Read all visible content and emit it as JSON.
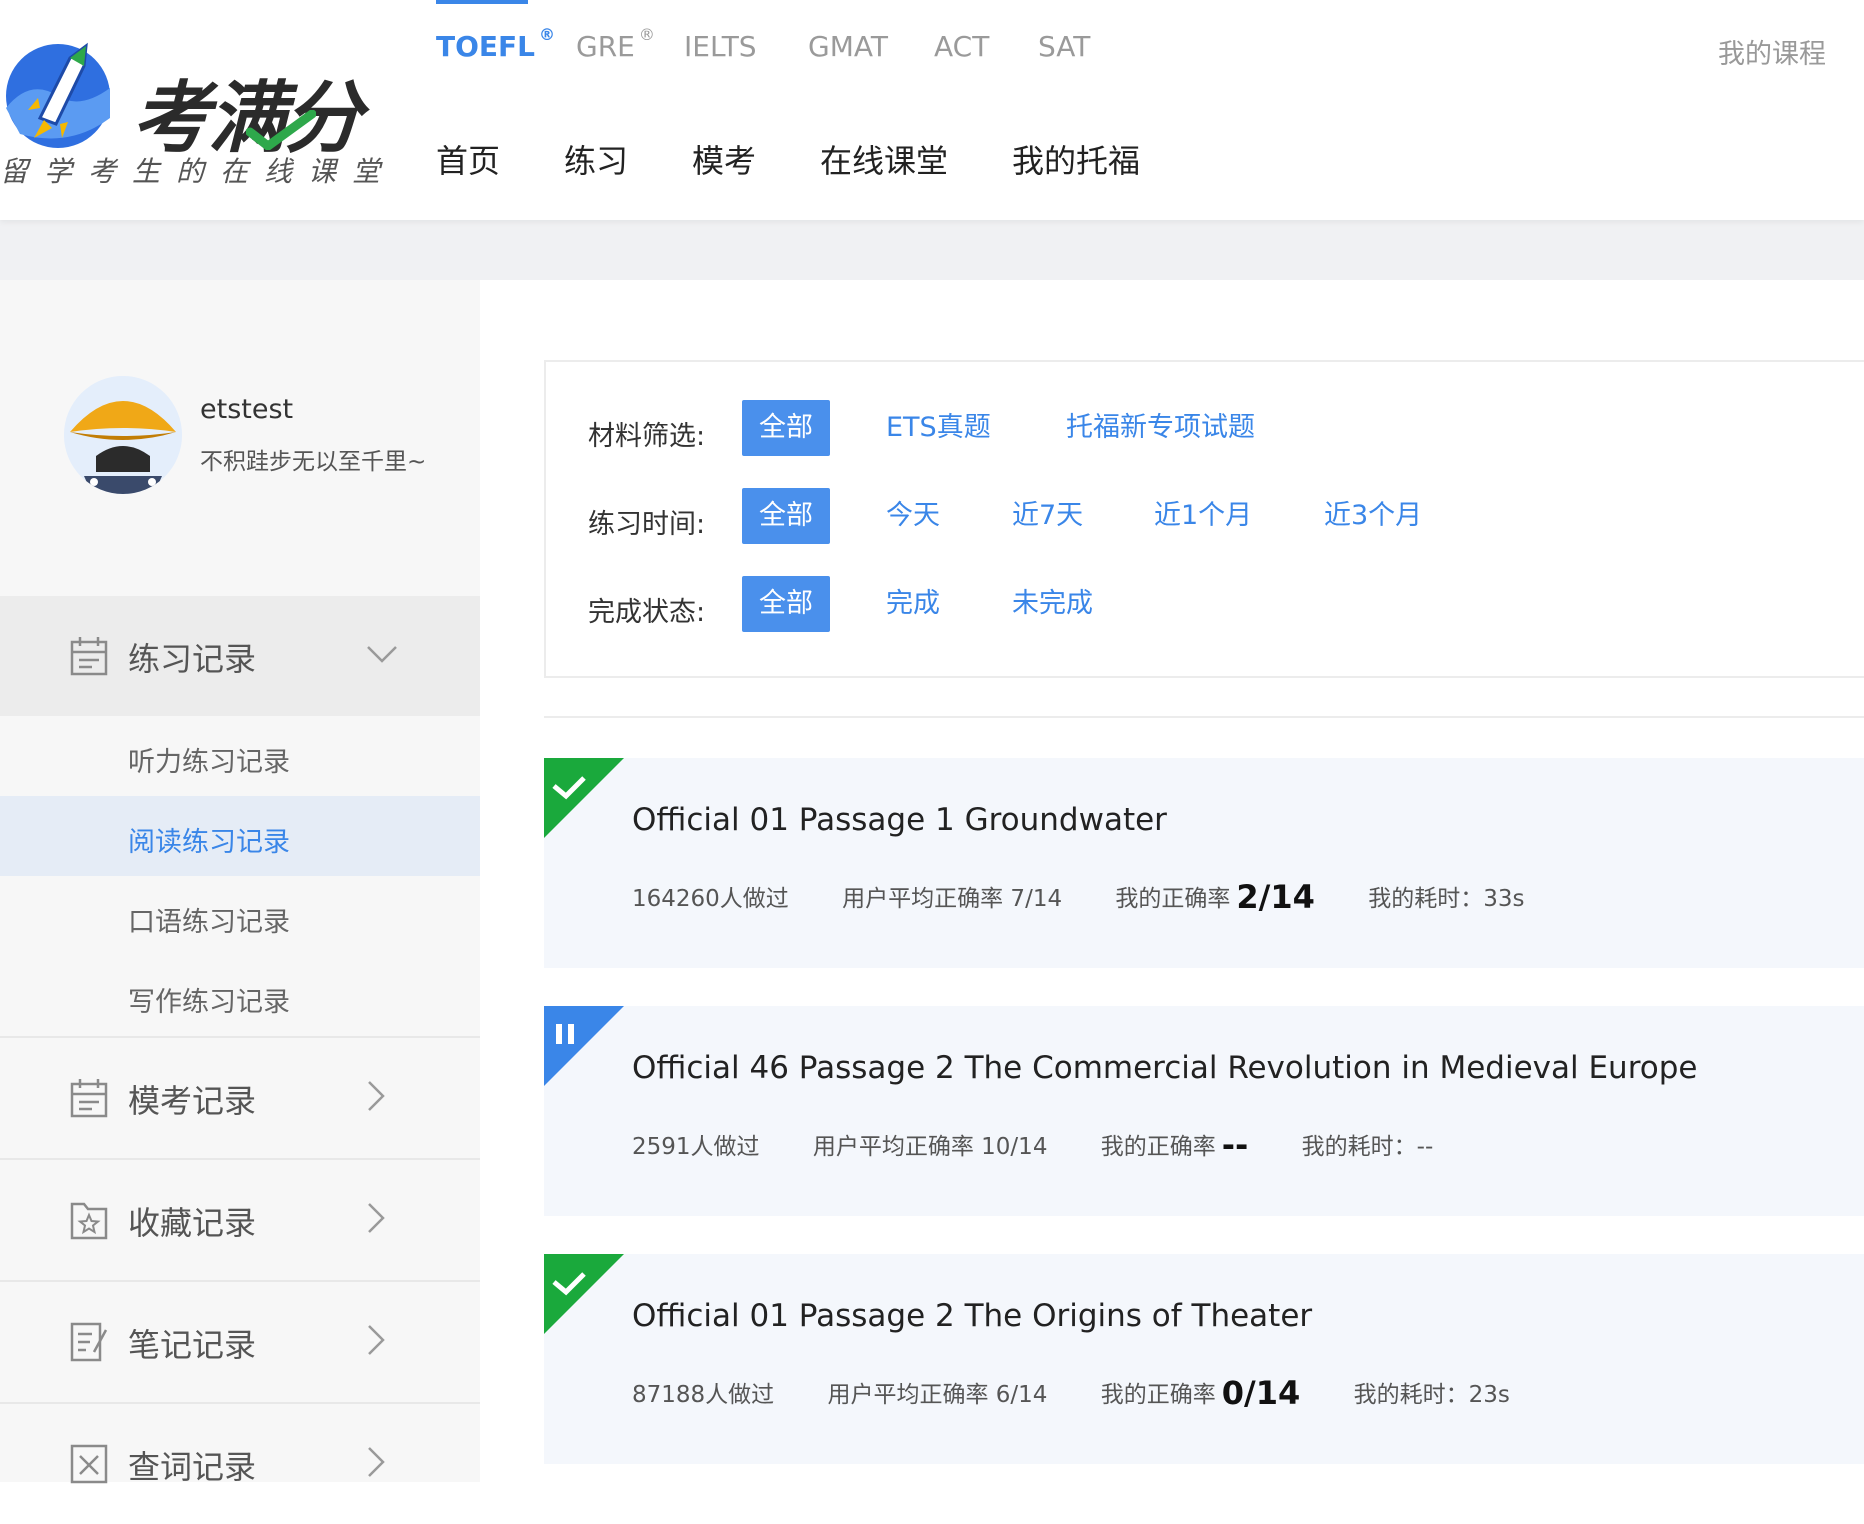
{
  "brand": {
    "name": "考满分",
    "slogan": "留学考生的在线课堂",
    "colors": {
      "accent": "#3a86e8",
      "success": "#1aa93c",
      "paused": "#3a86e8"
    }
  },
  "exam_tabs": [
    {
      "label": "TOEFL",
      "reg": "®",
      "active": true
    },
    {
      "label": "GRE",
      "reg": "®"
    },
    {
      "label": "IELTS",
      "reg": ""
    },
    {
      "label": "GMAT",
      "reg": ""
    },
    {
      "label": "ACT",
      "reg": ""
    },
    {
      "label": "SAT",
      "reg": ""
    }
  ],
  "my_course": "我的课程",
  "main_nav": [
    "首页",
    "练习",
    "模考",
    "在线课堂",
    "我的托福"
  ],
  "user": {
    "name": "etstest",
    "motto": "不积跬步无以至千里~"
  },
  "sidebar": {
    "groups": [
      {
        "label": "练习记录",
        "icon": "calendar-icon",
        "expanded": true
      },
      {
        "label": "模考记录",
        "icon": "calendar-icon"
      },
      {
        "label": "收藏记录",
        "icon": "star-folder-icon"
      },
      {
        "label": "笔记记录",
        "icon": "note-icon"
      },
      {
        "label": "查词记录",
        "icon": "dictionary-icon"
      }
    ],
    "sub_items": [
      "听力练习记录",
      "阅读练习记录",
      "口语练习记录",
      "写作练习记录"
    ],
    "active_sub": "阅读练习记录"
  },
  "filters": {
    "material": {
      "label": "材料筛选:",
      "options": [
        "全部",
        "ETS真题",
        "托福新专项试题"
      ],
      "selected": "全部"
    },
    "time": {
      "label": "练习时间:",
      "options": [
        "全部",
        "今天",
        "近7天",
        "近1个月",
        "近3个月"
      ],
      "selected": "全部"
    },
    "status": {
      "label": "完成状态:",
      "options": [
        "全部",
        "完成",
        "未完成"
      ],
      "selected": "全部"
    }
  },
  "records": [
    {
      "status": "complete",
      "title": "Official 01 Passage 1  Groundwater",
      "done": "164260人做过",
      "avg_label": "用户平均正确率 7/14",
      "my_label": "我的正确率",
      "my_value": "2/14",
      "time": "我的耗时：33s"
    },
    {
      "status": "paused",
      "title": "Official 46 Passage 2  The Commercial Revolution in Medieval Europe",
      "done": "2591人做过",
      "avg_label": "用户平均正确率 10/14",
      "my_label": "我的正确率",
      "my_value": "--",
      "time": "我的耗时：--"
    },
    {
      "status": "complete",
      "title": "Official 01 Passage 2  The Origins of Theater",
      "done": "87188人做过",
      "avg_label": "用户平均正确率 6/14",
      "my_label": "我的正确率",
      "my_value": "0/14",
      "time": "我的耗时：23s"
    }
  ]
}
